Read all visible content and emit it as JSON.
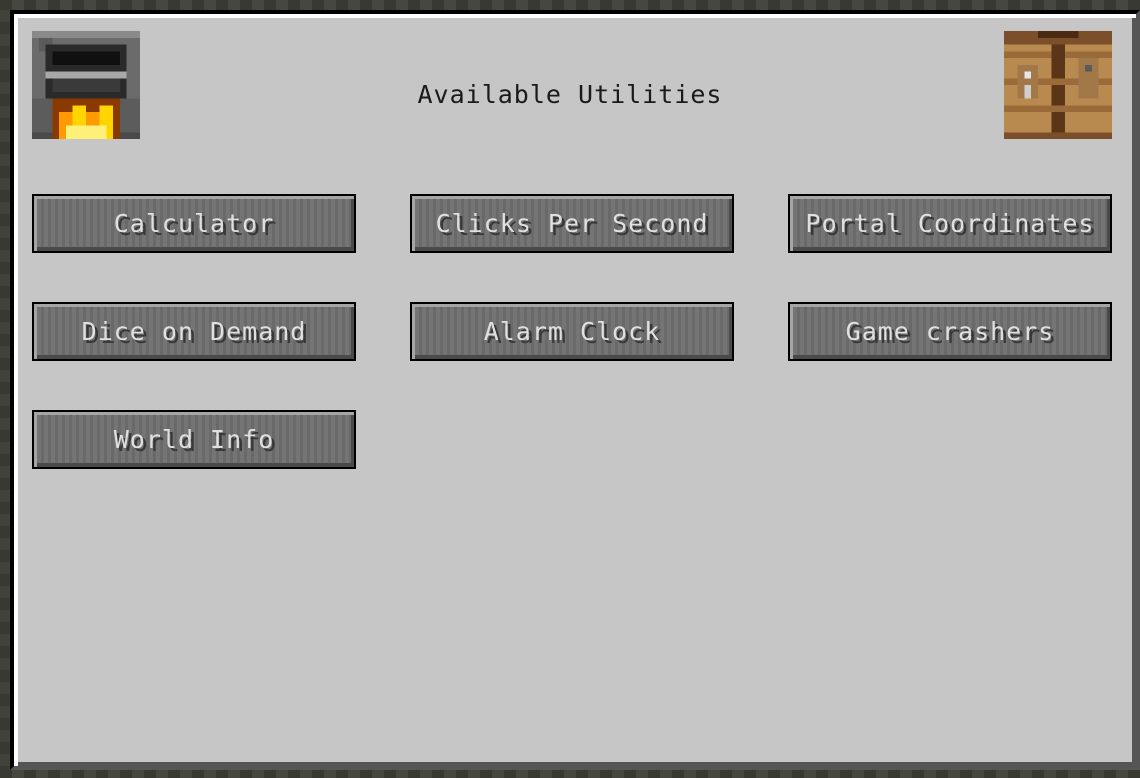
{
  "screen": {
    "title": "Available Utilities"
  },
  "icons": {
    "left": "furnace-icon",
    "right": "crafting-table-icon"
  },
  "buttons": [
    {
      "label": "Calculator"
    },
    {
      "label": "Clicks Per Second"
    },
    {
      "label": "Portal Coordinates"
    },
    {
      "label": "Dice on Demand"
    },
    {
      "label": "Alarm Clock"
    },
    {
      "label": "Game crashers"
    },
    {
      "label": "World Info"
    }
  ],
  "colors": {
    "panel": "#c6c6c6",
    "button": "#6f6f6f",
    "button_text": "#e0e0e0",
    "title_text": "#1a1a1a"
  }
}
